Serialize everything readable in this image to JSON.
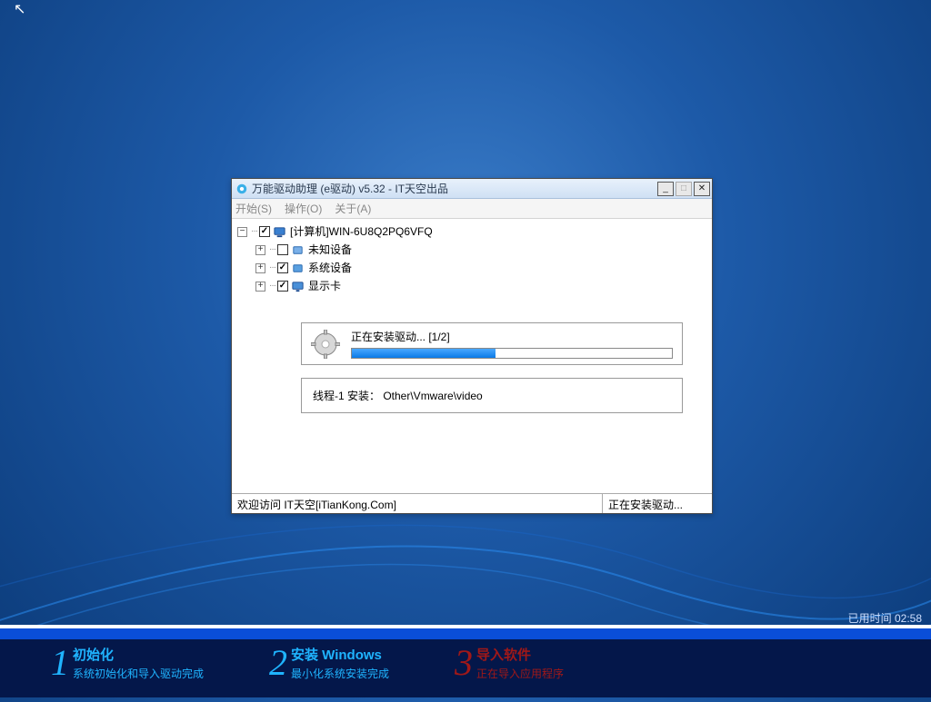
{
  "window": {
    "title": "万能驱动助理 (e驱动) v5.32 - IT天空出品",
    "menus": {
      "start": "开始(S)",
      "action": "操作(O)",
      "about": "关于(A)"
    },
    "statusbar": {
      "left": "欢迎访问 IT天空[iTianKong.Com]",
      "right": "正在安装驱动..."
    }
  },
  "tree": {
    "root": {
      "label": "[计算机]WIN-6U8Q2PQ6VFQ",
      "checked": true,
      "exp": "−"
    },
    "children": [
      {
        "label": "未知设备",
        "checked": false,
        "exp": "+"
      },
      {
        "label": "系统设备",
        "checked": true,
        "exp": "+"
      },
      {
        "label": "显示卡",
        "checked": true,
        "exp": "+"
      }
    ]
  },
  "progress": {
    "label": "正在安装驱动... [1/2]",
    "percent": 45,
    "thread": "线程-1 安装：  Other\\Vmware\\video"
  },
  "bottom": {
    "elapsed_label": "已用时间",
    "elapsed_value": "02:58",
    "steps": [
      {
        "num": "1",
        "title": "初始化",
        "sub": "系统初始化和导入驱动完成",
        "tone": "blue"
      },
      {
        "num": "2",
        "title": "安装 Windows",
        "sub": "最小化系统安装完成",
        "tone": "blue"
      },
      {
        "num": "3",
        "title": "导入软件",
        "sub": "正在导入应用程序",
        "tone": "red"
      }
    ]
  }
}
